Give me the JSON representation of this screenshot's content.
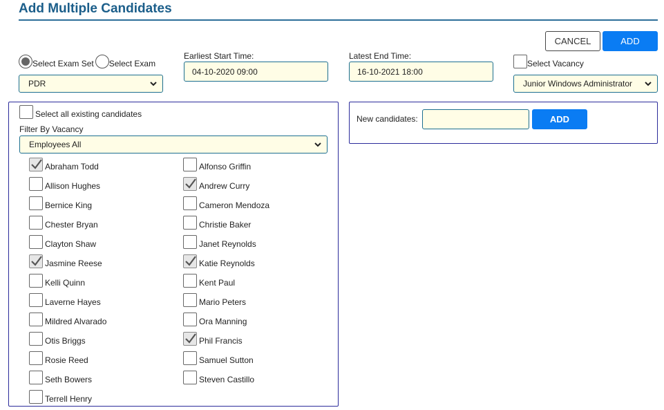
{
  "page": {
    "title": "Add Multiple Candidates"
  },
  "actions": {
    "cancel_label": "CANCEL",
    "add_label": "ADD"
  },
  "exam_mode": {
    "options": [
      {
        "label": "Select Exam Set",
        "checked": true
      },
      {
        "label": "Select Exam",
        "checked": false
      }
    ],
    "selected_value": "PDR"
  },
  "earliest_start": {
    "label": "Earliest Start Time:",
    "value": "04-10-2020 09:00"
  },
  "latest_end": {
    "label": "Latest End Time:",
    "value": "16-10-2021 18:00"
  },
  "vacancy": {
    "label": "Select Vacancy",
    "checked": false,
    "selected_value": "Junior Windows Administrator"
  },
  "existing": {
    "select_all_label": "Select all existing candidates",
    "filter_label": "Filter By Vacancy",
    "filter_value": "Employees All",
    "candidates": [
      {
        "name": "Abraham Todd",
        "checked": true
      },
      {
        "name": "Alfonso Griffin",
        "checked": false
      },
      {
        "name": "Allison Hughes",
        "checked": false
      },
      {
        "name": "Andrew Curry",
        "checked": true
      },
      {
        "name": "Bernice King",
        "checked": false
      },
      {
        "name": "Cameron Mendoza",
        "checked": false
      },
      {
        "name": "Chester Bryan",
        "checked": false
      },
      {
        "name": "Christie Baker",
        "checked": false
      },
      {
        "name": "Clayton Shaw",
        "checked": false
      },
      {
        "name": "Janet Reynolds",
        "checked": false
      },
      {
        "name": "Jasmine Reese",
        "checked": true
      },
      {
        "name": "Katie Reynolds",
        "checked": true
      },
      {
        "name": "Kelli Quinn",
        "checked": false
      },
      {
        "name": "Kent Paul",
        "checked": false
      },
      {
        "name": "Laverne Hayes",
        "checked": false
      },
      {
        "name": "Mario Peters",
        "checked": false
      },
      {
        "name": "Mildred Alvarado",
        "checked": false
      },
      {
        "name": "Ora Manning",
        "checked": false
      },
      {
        "name": "Otis Briggs",
        "checked": false
      },
      {
        "name": "Phil Francis",
        "checked": true
      },
      {
        "name": "Rosie Reed",
        "checked": false
      },
      {
        "name": "Samuel Sutton",
        "checked": false
      },
      {
        "name": "Seth Bowers",
        "checked": false
      },
      {
        "name": "Steven Castillo",
        "checked": false
      },
      {
        "name": "Terrell Henry",
        "checked": false
      }
    ]
  },
  "new_candidates": {
    "label": "New candidates:",
    "value": "",
    "add_label": "ADD"
  },
  "colors": {
    "accent": "#0a7cf3",
    "title": "#1b5e8a",
    "field_bg": "#fffde6",
    "panel_border": "#2a2a9a"
  }
}
